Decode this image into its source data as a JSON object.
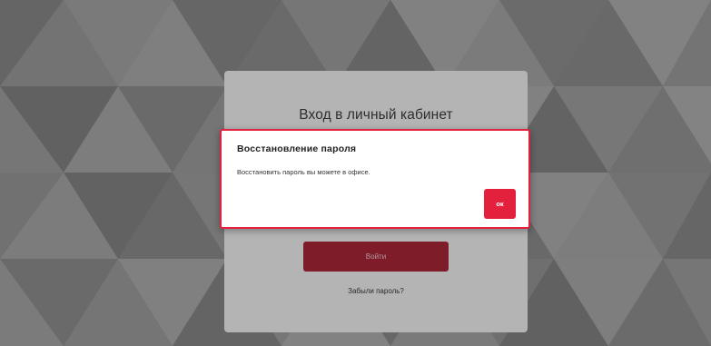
{
  "colors": {
    "accent": "#e3213d",
    "login_button_dim": "#7f1c2a",
    "page_bg": "#7a7a7a",
    "card_bg": "#b4b4b4"
  },
  "login": {
    "title": "Вход в личный кабинет",
    "submit_label": "Войти",
    "forgot_label": "Забыли пароль?"
  },
  "dialog": {
    "title": "Восстановление пароля",
    "message": "Восстановить пароль вы можете в офисе.",
    "ok_label": "ок"
  }
}
